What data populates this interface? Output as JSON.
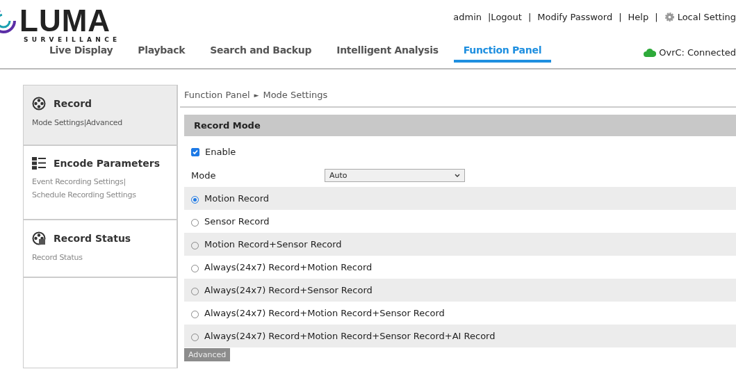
{
  "logo": {
    "name": "LUMA",
    "tagline": "SURVEILLANCE"
  },
  "top_links": [
    {
      "label": "admin",
      "kind": "text"
    },
    {
      "label": "|Logout",
      "kind": "link"
    },
    {
      "label": "|",
      "kind": "sep"
    },
    {
      "label": "Modify Password",
      "kind": "link"
    },
    {
      "label": "|",
      "kind": "sep"
    },
    {
      "label": "Help",
      "kind": "link"
    },
    {
      "label": "|",
      "kind": "sep"
    },
    {
      "label": "Local Setting",
      "kind": "settings"
    }
  ],
  "tabs": [
    {
      "label": "Live Display",
      "selected": false
    },
    {
      "label": "Playback",
      "selected": false
    },
    {
      "label": "Search and Backup",
      "selected": false
    },
    {
      "label": "Intelligent Analysis",
      "selected": false
    },
    {
      "label": "Function Panel",
      "selected": true
    }
  ],
  "ovrc": {
    "label": "OvrC:",
    "status": "Connected"
  },
  "sidebar": {
    "items": [
      {
        "title": "Record",
        "kind": "reel",
        "selected": true,
        "links": [
          "Mode Settings|Advanced"
        ]
      },
      {
        "title": "Encode Parameters",
        "kind": "list",
        "selected": false,
        "links": [
          "Event Recording Settings|",
          "Schedule Recording Settings"
        ]
      },
      {
        "title": "Record Status",
        "kind": "reel-status",
        "selected": false,
        "links": [
          "Record Status"
        ]
      }
    ]
  },
  "breadcrumb": [
    "Function Panel",
    "►",
    "Mode Settings"
  ],
  "section": {
    "title": "Record Mode",
    "enable": {
      "label": "Enable",
      "checked": true
    },
    "mode": {
      "label": "Mode",
      "value": "Auto"
    },
    "options": [
      {
        "label": "Motion Record",
        "selected": true
      },
      {
        "label": "Sensor Record",
        "selected": false
      },
      {
        "label": "Motion Record+Sensor Record",
        "selected": false
      },
      {
        "label": "Always(24x7) Record+Motion Record",
        "selected": false
      },
      {
        "label": "Always(24x7) Record+Sensor Record",
        "selected": false
      },
      {
        "label": "Always(24x7) Record+Motion Record+Sensor Record",
        "selected": false
      },
      {
        "label": "Always(24x7) Record+Motion Record+Sensor Record+AI Record",
        "selected": false
      }
    ],
    "button": "Advanced"
  }
}
